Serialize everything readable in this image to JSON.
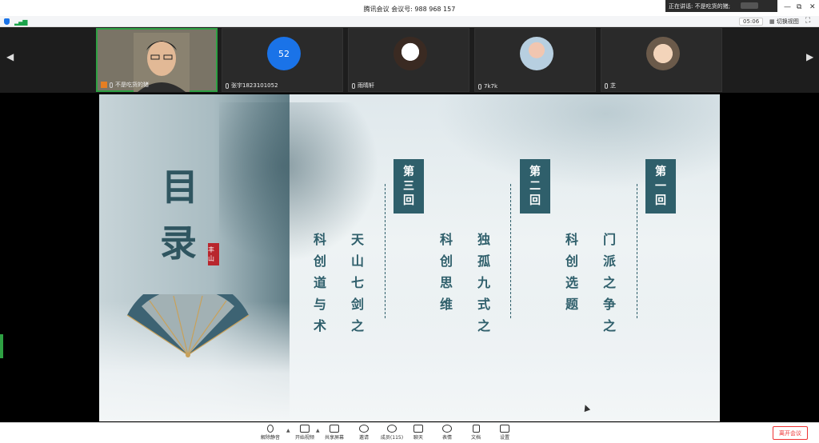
{
  "window": {
    "title": "腾讯会议  会议号: 988 968 157",
    "speaking_tip": "正在讲话: 不是吃货的猪;",
    "controls": [
      "—",
      "⧉",
      "✕"
    ]
  },
  "status": {
    "timer": "05:06",
    "switch_view": "切换视图"
  },
  "participants": [
    {
      "name": "不是吃货的猪",
      "active": true
    },
    {
      "name": "张宇1823101052",
      "avatar_text": "52"
    },
    {
      "name": "雨晴轩"
    },
    {
      "name": "7k7k"
    },
    {
      "name": "芝"
    }
  ],
  "slide": {
    "mulu": [
      "目",
      "录"
    ],
    "seal": "丰山",
    "sections": [
      {
        "badge": [
          "第",
          "一",
          "回"
        ],
        "lines": [
          "门派之争之",
          "科创选题"
        ]
      },
      {
        "badge": [
          "第",
          "二",
          "回"
        ],
        "lines": [
          "独孤九式之",
          "科创思维"
        ]
      },
      {
        "badge": [
          "第",
          "三",
          "回"
        ],
        "lines": [
          "天山七剑之",
          "科创道与术"
        ]
      }
    ]
  },
  "toolbar": {
    "unmute": "解除静音",
    "start_video": "开始视频",
    "share": "共享屏幕",
    "invite": "邀请",
    "members": "成员(115)",
    "chat": "聊天",
    "reactions": "表情",
    "docs": "文档",
    "settings": "设置",
    "leave": "离开会议"
  },
  "colors": {
    "accent": "#2f5f6b",
    "active_border": "#2ea043",
    "leave": "#e33333",
    "avatar_blue": "#1a73e8"
  }
}
